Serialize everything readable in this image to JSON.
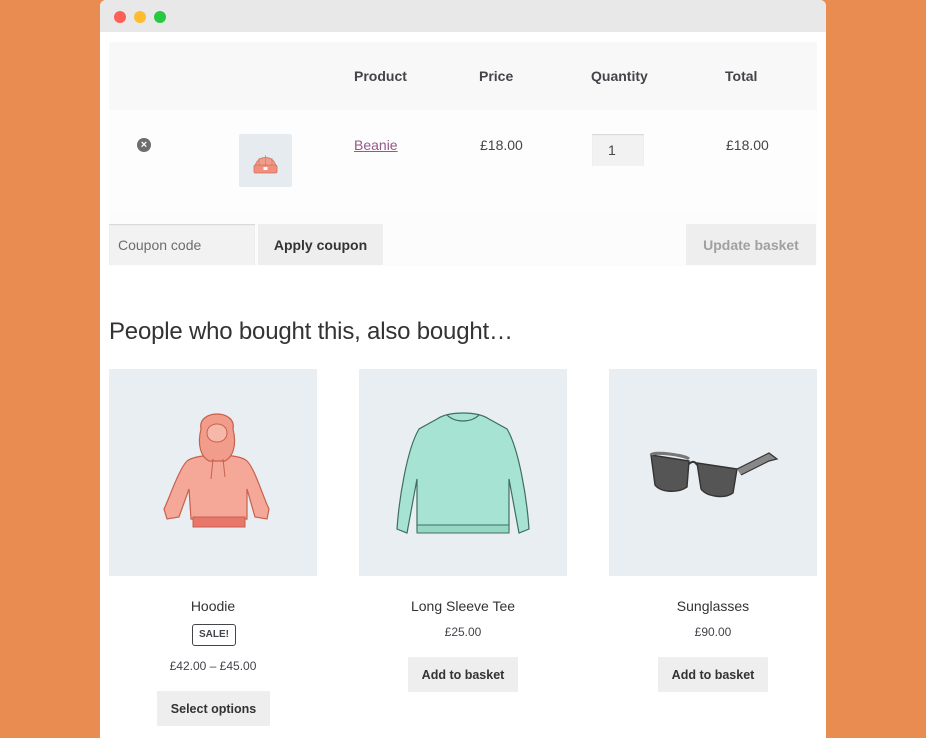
{
  "cart": {
    "headers": {
      "product": "Product",
      "price": "Price",
      "quantity": "Quantity",
      "total": "Total"
    },
    "items": [
      {
        "name": "Beanie",
        "price": "£18.00",
        "quantity": "1",
        "total": "£18.00",
        "remove_icon": "close-circle-icon"
      }
    ],
    "coupon_placeholder": "Coupon code",
    "apply_coupon_label": "Apply coupon",
    "update_basket_label": "Update basket"
  },
  "cross_sells": {
    "title": "People who bought this, also bought…",
    "products": [
      {
        "name": "Hoodie",
        "badge": "SALE!",
        "price": "£42.00 – £45.00",
        "button": "Select options",
        "color": "#f29d8b"
      },
      {
        "name": "Long Sleeve Tee",
        "price": "£25.00",
        "button": "Add to basket",
        "color": "#a6e3d2"
      },
      {
        "name": "Sunglasses",
        "price": "£90.00",
        "button": "Add to basket",
        "color": "#777777"
      }
    ]
  },
  "colors": {
    "background": "#e98c51",
    "link": "#96588a"
  }
}
